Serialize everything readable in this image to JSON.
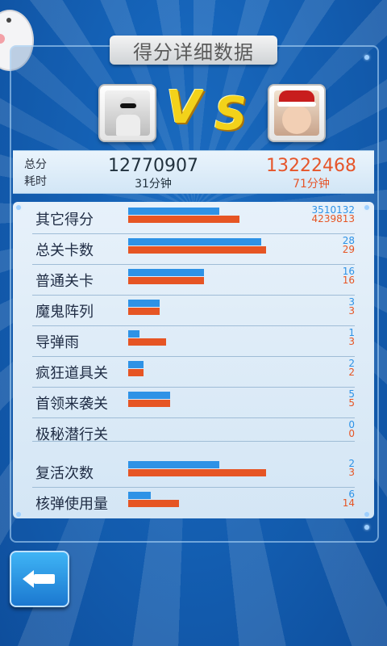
{
  "title": "得分详细数据",
  "players": {
    "p1": {
      "score": "12770907",
      "time": "31分钟"
    },
    "p2": {
      "score": "13222468",
      "time": "71分钟"
    }
  },
  "labels": {
    "total_score": "总分",
    "time_used": "耗时"
  },
  "vs": {
    "v": "V",
    "s": "S"
  },
  "stats": [
    {
      "name": "其它得分",
      "p1": "3510132",
      "p2": "4239813",
      "p1_fraction": 0.41,
      "p2_fraction": 0.5
    },
    {
      "name": "总关卡数",
      "p1": "28",
      "p2": "29",
      "p1_fraction": 0.6,
      "p2_fraction": 0.62
    },
    {
      "name": "普通关卡",
      "p1": "16",
      "p2": "16",
      "p1_fraction": 0.34,
      "p2_fraction": 0.34
    },
    {
      "name": "魔鬼阵列",
      "p1": "3",
      "p2": "3",
      "p1_fraction": 0.14,
      "p2_fraction": 0.14
    },
    {
      "name": "导弹雨",
      "p1": "1",
      "p2": "3",
      "p1_fraction": 0.05,
      "p2_fraction": 0.17
    },
    {
      "name": "疯狂道具关",
      "p1": "2",
      "p2": "2",
      "p1_fraction": 0.07,
      "p2_fraction": 0.07
    },
    {
      "name": "首领来袭关",
      "p1": "5",
      "p2": "5",
      "p1_fraction": 0.19,
      "p2_fraction": 0.19
    },
    {
      "name": "极秘潜行关",
      "p1": "0",
      "p2": "0",
      "p1_fraction": 0,
      "p2_fraction": 0
    },
    {
      "name": "复活次数",
      "p1": "2",
      "p2": "3",
      "p1_fraction": 0.41,
      "p2_fraction": 0.62
    },
    {
      "name": "核弹使用量",
      "p1": "6",
      "p2": "14",
      "p1_fraction": 0.1,
      "p2_fraction": 0.23
    }
  ],
  "colors": {
    "p1": "#2e92e6",
    "p2": "#e65524"
  },
  "icons": {
    "back": "back-arrow-icon"
  }
}
